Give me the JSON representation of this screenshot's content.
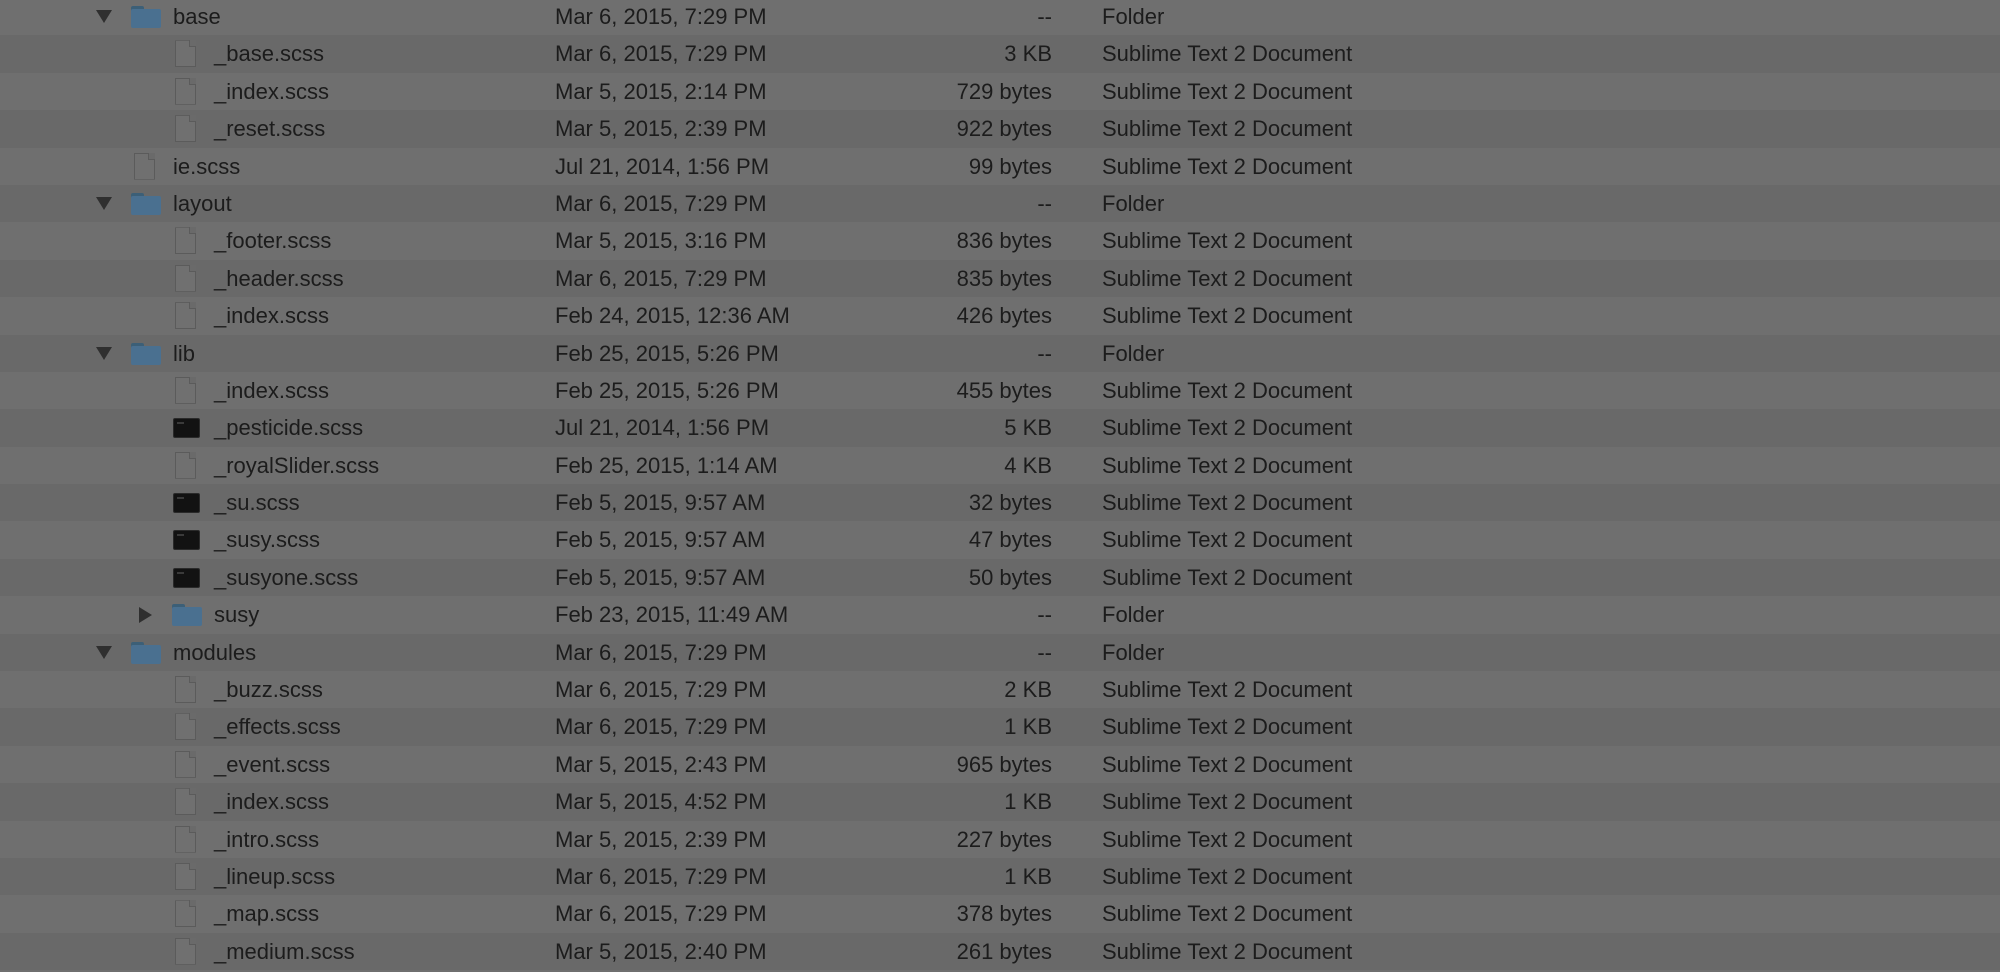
{
  "rows": [
    {
      "name": "base",
      "date": "Mar 6, 2015, 7:29 PM",
      "size": "--",
      "kind": "Folder",
      "type": "folder",
      "level": 0,
      "disclosure": "expanded",
      "icon": "folder-icon"
    },
    {
      "name": "_base.scss",
      "date": "Mar 6, 2015, 7:29 PM",
      "size": "3 KB",
      "kind": "Sublime Text 2 Document",
      "type": "doc",
      "level": 1,
      "disclosure": "none",
      "icon": "document-icon"
    },
    {
      "name": "_index.scss",
      "date": "Mar 5, 2015, 2:14 PM",
      "size": "729 bytes",
      "kind": "Sublime Text 2 Document",
      "type": "doc",
      "level": 1,
      "disclosure": "none",
      "icon": "document-icon"
    },
    {
      "name": "_reset.scss",
      "date": "Mar 5, 2015, 2:39 PM",
      "size": "922 bytes",
      "kind": "Sublime Text 2 Document",
      "type": "doc",
      "level": 1,
      "disclosure": "none",
      "icon": "document-icon"
    },
    {
      "name": "ie.scss",
      "date": "Jul 21, 2014, 1:56 PM",
      "size": "99 bytes",
      "kind": "Sublime Text 2 Document",
      "type": "doc",
      "level": 0,
      "disclosure": "none",
      "icon": "document-icon"
    },
    {
      "name": "layout",
      "date": "Mar 6, 2015, 7:29 PM",
      "size": "--",
      "kind": "Folder",
      "type": "folder",
      "level": 0,
      "disclosure": "expanded",
      "icon": "folder-icon"
    },
    {
      "name": "_footer.scss",
      "date": "Mar 5, 2015, 3:16 PM",
      "size": "836 bytes",
      "kind": "Sublime Text 2 Document",
      "type": "doc",
      "level": 1,
      "disclosure": "none",
      "icon": "document-icon"
    },
    {
      "name": "_header.scss",
      "date": "Mar 6, 2015, 7:29 PM",
      "size": "835 bytes",
      "kind": "Sublime Text 2 Document",
      "type": "doc",
      "level": 1,
      "disclosure": "none",
      "icon": "document-icon"
    },
    {
      "name": "_index.scss",
      "date": "Feb 24, 2015, 12:36 AM",
      "size": "426 bytes",
      "kind": "Sublime Text 2 Document",
      "type": "doc",
      "level": 1,
      "disclosure": "none",
      "icon": "document-icon"
    },
    {
      "name": "lib",
      "date": "Feb 25, 2015, 5:26 PM",
      "size": "--",
      "kind": "Folder",
      "type": "folder",
      "level": 0,
      "disclosure": "expanded",
      "icon": "folder-icon"
    },
    {
      "name": "_index.scss",
      "date": "Feb 25, 2015, 5:26 PM",
      "size": "455 bytes",
      "kind": "Sublime Text 2 Document",
      "type": "doc",
      "level": 1,
      "disclosure": "none",
      "icon": "document-icon"
    },
    {
      "name": "_pesticide.scss",
      "date": "Jul 21, 2014, 1:56 PM",
      "size": "5 KB",
      "kind": "Sublime Text 2 Document",
      "type": "term",
      "level": 1,
      "disclosure": "none",
      "icon": "terminal-icon"
    },
    {
      "name": "_royalSlider.scss",
      "date": "Feb 25, 2015, 1:14 AM",
      "size": "4 KB",
      "kind": "Sublime Text 2 Document",
      "type": "doc",
      "level": 1,
      "disclosure": "none",
      "icon": "document-icon"
    },
    {
      "name": "_su.scss",
      "date": "Feb 5, 2015, 9:57 AM",
      "size": "32 bytes",
      "kind": "Sublime Text 2 Document",
      "type": "term",
      "level": 1,
      "disclosure": "none",
      "icon": "terminal-icon"
    },
    {
      "name": "_susy.scss",
      "date": "Feb 5, 2015, 9:57 AM",
      "size": "47 bytes",
      "kind": "Sublime Text 2 Document",
      "type": "term",
      "level": 1,
      "disclosure": "none",
      "icon": "terminal-icon"
    },
    {
      "name": "_susyone.scss",
      "date": "Feb 5, 2015, 9:57 AM",
      "size": "50 bytes",
      "kind": "Sublime Text 2 Document",
      "type": "term",
      "level": 1,
      "disclosure": "none",
      "icon": "terminal-icon"
    },
    {
      "name": "susy",
      "date": "Feb 23, 2015, 11:49 AM",
      "size": "--",
      "kind": "Folder",
      "type": "folder",
      "level": 1,
      "disclosure": "collapsed",
      "icon": "folder-icon"
    },
    {
      "name": "modules",
      "date": "Mar 6, 2015, 7:29 PM",
      "size": "--",
      "kind": "Folder",
      "type": "folder",
      "level": 0,
      "disclosure": "expanded",
      "icon": "folder-icon"
    },
    {
      "name": "_buzz.scss",
      "date": "Mar 6, 2015, 7:29 PM",
      "size": "2 KB",
      "kind": "Sublime Text 2 Document",
      "type": "doc",
      "level": 1,
      "disclosure": "none",
      "icon": "document-icon"
    },
    {
      "name": "_effects.scss",
      "date": "Mar 6, 2015, 7:29 PM",
      "size": "1 KB",
      "kind": "Sublime Text 2 Document",
      "type": "doc",
      "level": 1,
      "disclosure": "none",
      "icon": "document-icon"
    },
    {
      "name": "_event.scss",
      "date": "Mar 5, 2015, 2:43 PM",
      "size": "965 bytes",
      "kind": "Sublime Text 2 Document",
      "type": "doc",
      "level": 1,
      "disclosure": "none",
      "icon": "document-icon"
    },
    {
      "name": "_index.scss",
      "date": "Mar 5, 2015, 4:52 PM",
      "size": "1 KB",
      "kind": "Sublime Text 2 Document",
      "type": "doc",
      "level": 1,
      "disclosure": "none",
      "icon": "document-icon"
    },
    {
      "name": "_intro.scss",
      "date": "Mar 5, 2015, 2:39 PM",
      "size": "227 bytes",
      "kind": "Sublime Text 2 Document",
      "type": "doc",
      "level": 1,
      "disclosure": "none",
      "icon": "document-icon"
    },
    {
      "name": "_lineup.scss",
      "date": "Mar 6, 2015, 7:29 PM",
      "size": "1 KB",
      "kind": "Sublime Text 2 Document",
      "type": "doc",
      "level": 1,
      "disclosure": "none",
      "icon": "document-icon"
    },
    {
      "name": "_map.scss",
      "date": "Mar 6, 2015, 7:29 PM",
      "size": "378 bytes",
      "kind": "Sublime Text 2 Document",
      "type": "doc",
      "level": 1,
      "disclosure": "none",
      "icon": "document-icon"
    },
    {
      "name": "_medium.scss",
      "date": "Mar 5, 2015, 2:40 PM",
      "size": "261 bytes",
      "kind": "Sublime Text 2 Document",
      "type": "doc",
      "level": 1,
      "disclosure": "none",
      "icon": "document-icon"
    }
  ]
}
